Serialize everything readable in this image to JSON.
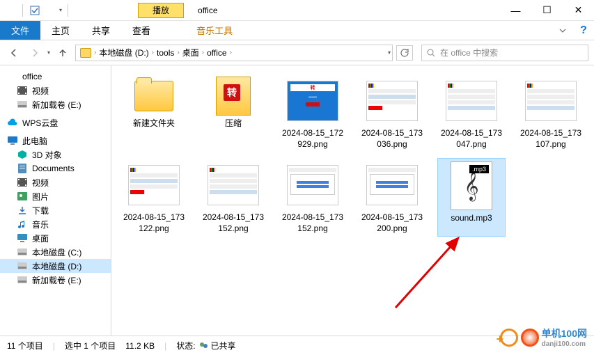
{
  "window": {
    "play_tab": "播放",
    "title": "office",
    "min": "—",
    "max": "☐",
    "close": "✕"
  },
  "ribbon": {
    "file": "文件",
    "home": "主页",
    "share": "共享",
    "view": "查看",
    "music_tools": "音乐工具"
  },
  "nav": {
    "crumbs": [
      "本地磁盘 (D:)",
      "tools",
      "桌面",
      "office"
    ],
    "search_placeholder": "在 office 中搜索"
  },
  "sidebar": {
    "quick": [
      {
        "label": "office",
        "icon": "folder",
        "color": "#ffc840"
      },
      {
        "label": "视频",
        "icon": "video",
        "color": "#555"
      },
      {
        "label": "新加载卷 (E:)",
        "icon": "drive",
        "color": "#888"
      }
    ],
    "wps": {
      "label": "WPS云盘",
      "icon": "cloud",
      "color": "#00a0e9"
    },
    "pc": {
      "label": "此电脑",
      "icon": "pc",
      "color": "#1979ca"
    },
    "pc_items": [
      {
        "label": "3D 对象",
        "icon": "3d",
        "color": "#00b0a0"
      },
      {
        "label": "Documents",
        "icon": "doc",
        "color": "#5090c0"
      },
      {
        "label": "视频",
        "icon": "video",
        "color": "#555"
      },
      {
        "label": "图片",
        "icon": "pic",
        "color": "#40a060"
      },
      {
        "label": "下载",
        "icon": "down",
        "color": "#3070c0"
      },
      {
        "label": "音乐",
        "icon": "music",
        "color": "#1979ca"
      },
      {
        "label": "桌面",
        "icon": "desk",
        "color": "#3090c0"
      },
      {
        "label": "本地磁盘 (C:)",
        "icon": "drive",
        "color": "#888"
      },
      {
        "label": "本地磁盘 (D:)",
        "icon": "drive",
        "color": "#888",
        "selected": true
      },
      {
        "label": "新加载卷 (E:)",
        "icon": "drive",
        "color": "#888"
      }
    ]
  },
  "files": [
    {
      "name": "新建文件夹",
      "type": "folder"
    },
    {
      "name": "压缩",
      "type": "zip"
    },
    {
      "name": "2024-08-15_172929.png",
      "type": "img",
      "variant": "blue"
    },
    {
      "name": "2024-08-15_173036.png",
      "type": "img",
      "variant": "app"
    },
    {
      "name": "2024-08-15_173047.png",
      "type": "img",
      "variant": "list"
    },
    {
      "name": "2024-08-15_173107.png",
      "type": "img",
      "variant": "list"
    },
    {
      "name": "2024-08-15_173122.png",
      "type": "img",
      "variant": "app2"
    },
    {
      "name": "2024-08-15_173152.png",
      "type": "img",
      "variant": "list2"
    },
    {
      "name": "2024-08-15_173152.png",
      "type": "img",
      "variant": "dialog"
    },
    {
      "name": "2024-08-15_173200.png",
      "type": "img",
      "variant": "dialog"
    },
    {
      "name": "sound.mp3",
      "type": "mp3",
      "badge": ".mp3",
      "selected": true
    }
  ],
  "status": {
    "count": "11 个项目",
    "selected": "选中 1 个项目",
    "size": "11.2 KB",
    "state_label": "状态:",
    "state": "已共享"
  },
  "watermark": {
    "text1": "单机100网",
    "text2": "danji100.com"
  }
}
